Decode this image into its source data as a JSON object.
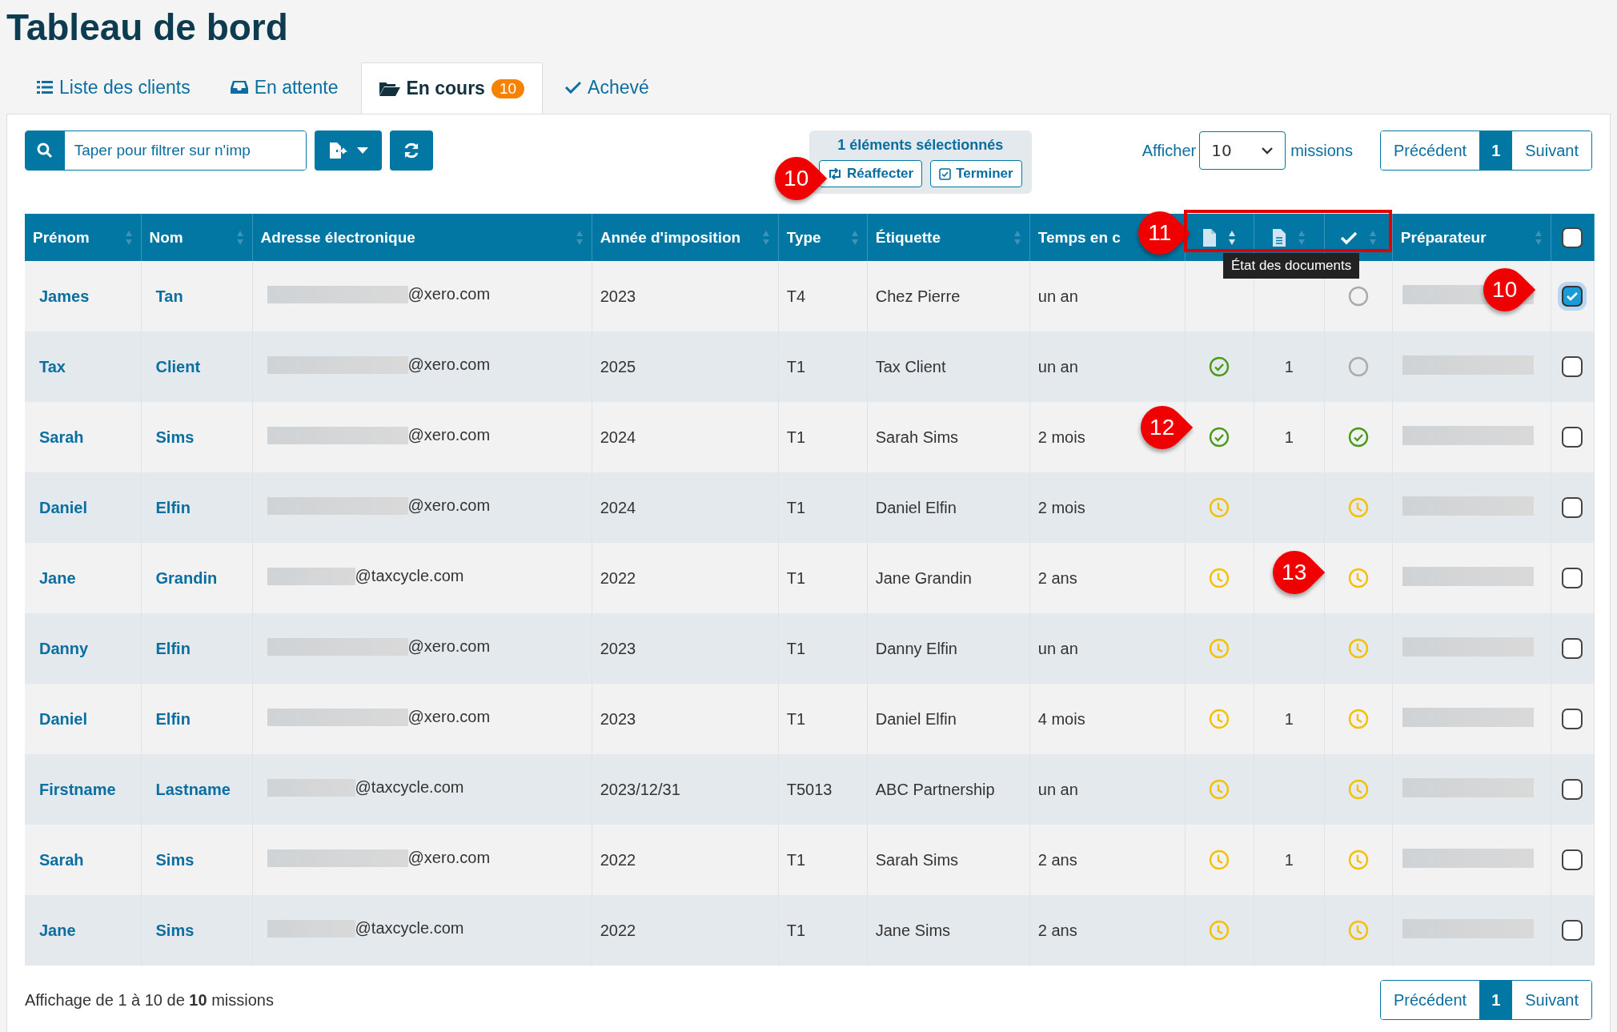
{
  "page_title": "Tableau de bord",
  "tabs": [
    {
      "label": "Liste des clients",
      "selected": false
    },
    {
      "label": "En attente",
      "selected": false
    },
    {
      "label": "En cours",
      "badge": "10",
      "selected": true
    },
    {
      "label": "Achevé",
      "selected": false
    }
  ],
  "search": {
    "placeholder": "Taper pour filtrer sur n'imp"
  },
  "selection": {
    "text": "1 éléments sélectionnés",
    "buttons": [
      {
        "label": "Réaffecter"
      },
      {
        "label": "Terminer"
      }
    ]
  },
  "page_size": {
    "label_before": "Afficher",
    "value": "10",
    "label_after": "missions"
  },
  "pagination_top": [
    {
      "label": "Précédent",
      "selected": false
    },
    {
      "label": "1",
      "selected": true
    },
    {
      "label": "Suivant",
      "selected": false
    }
  ],
  "table": {
    "columns": [
      {
        "label": "Prénom",
        "kind": "text"
      },
      {
        "label": "Nom",
        "kind": "text"
      },
      {
        "label": "Adresse électronique",
        "kind": "text"
      },
      {
        "label": "Année d'imposition",
        "kind": "text"
      },
      {
        "label": "Type",
        "kind": "text"
      },
      {
        "label": "Étiquette",
        "kind": "text"
      },
      {
        "label": "Temps en c",
        "kind": "text"
      },
      {
        "kind": "doc-icon"
      },
      {
        "kind": "doc-lines-icon"
      },
      {
        "kind": "check-icon"
      },
      {
        "label": "Préparateur",
        "kind": "text"
      },
      {
        "kind": "select-all",
        "checked": false
      }
    ],
    "rows": [
      {
        "first": "James",
        "last": "Tan",
        "email": "@xero.com",
        "year": "2023",
        "type": "T4",
        "label": "Chez Pierre",
        "time": "un an",
        "review_status": {
          "kind": "empty"
        },
        "selected": true
      },
      {
        "first": "Tax",
        "last": "Client",
        "email": "@xero.com",
        "year": "2025",
        "type": "T1",
        "label": "Tax Client",
        "time": "un an",
        "doc_status": {
          "kind": "done"
        },
        "doc_count": "1",
        "review_status": {
          "kind": "empty"
        },
        "selected": false
      },
      {
        "first": "Sarah",
        "last": "Sims",
        "email": "@xero.com",
        "year": "2024",
        "type": "T1",
        "label": "Sarah Sims",
        "time": "2 mois",
        "doc_status": {
          "kind": "done"
        },
        "doc_count": "1",
        "review_status": {
          "kind": "done"
        },
        "selected": false
      },
      {
        "first": "Daniel",
        "last": "Elfin",
        "email": "@xero.com",
        "year": "2024",
        "type": "T1",
        "label": "Daniel Elfin",
        "time": "2 mois",
        "doc_status": {
          "kind": "pending"
        },
        "review_status": {
          "kind": "pending"
        },
        "selected": false
      },
      {
        "first": "Jane",
        "last": "Grandin",
        "email": "@taxcycle.com",
        "year": "2022",
        "type": "T1",
        "label": "Jane Grandin",
        "time": "2 ans",
        "doc_status": {
          "kind": "pending"
        },
        "review_status": {
          "kind": "pending"
        },
        "selected": false
      },
      {
        "first": "Danny",
        "last": "Elfin",
        "email": "@xero.com",
        "year": "2023",
        "type": "T1",
        "label": "Danny Elfin",
        "time": "un an",
        "doc_status": {
          "kind": "pending"
        },
        "review_status": {
          "kind": "pending"
        },
        "selected": false
      },
      {
        "first": "Daniel",
        "last": "Elfin",
        "email": "@xero.com",
        "year": "2023",
        "type": "T1",
        "label": "Daniel Elfin",
        "time": "4 mois",
        "doc_status": {
          "kind": "pending"
        },
        "doc_count": "1",
        "review_status": {
          "kind": "pending"
        },
        "selected": false
      },
      {
        "first": "Firstname",
        "last": "Lastname",
        "email": "@taxcycle.com",
        "year": "2023/12/31",
        "type": "T5013",
        "label": "ABC Partnership",
        "time": "un an",
        "doc_status": {
          "kind": "pending"
        },
        "review_status": {
          "kind": "pending"
        },
        "selected": false
      },
      {
        "first": "Sarah",
        "last": "Sims",
        "email": "@xero.com",
        "year": "2022",
        "type": "T1",
        "label": "Sarah Sims",
        "time": "2 ans",
        "doc_status": {
          "kind": "pending"
        },
        "doc_count": "1",
        "review_status": {
          "kind": "pending"
        },
        "selected": false
      },
      {
        "first": "Jane",
        "last": "Sims",
        "email": "@taxcycle.com",
        "year": "2022",
        "type": "T1",
        "label": "Jane Sims",
        "time": "2 ans",
        "doc_status": {
          "kind": "pending"
        },
        "review_status": {
          "kind": "pending"
        },
        "selected": false
      }
    ]
  },
  "tooltip": "État des documents",
  "footer": {
    "summary": "Affichage de 1 à 10 de **10** missions"
  },
  "pagination_bottom": [
    {
      "label": "Précédent",
      "selected": false
    },
    {
      "label": "1",
      "selected": true
    },
    {
      "label": "Suivant",
      "selected": false
    }
  ],
  "annotations": [
    {
      "kind": "callout",
      "text": "10"
    },
    {
      "kind": "callout",
      "text": "11"
    },
    {
      "kind": "callout",
      "text": "10"
    },
    {
      "kind": "callout",
      "text": "12"
    },
    {
      "kind": "callout",
      "text": "13"
    },
    {
      "kind": "highlight-box"
    }
  ]
}
